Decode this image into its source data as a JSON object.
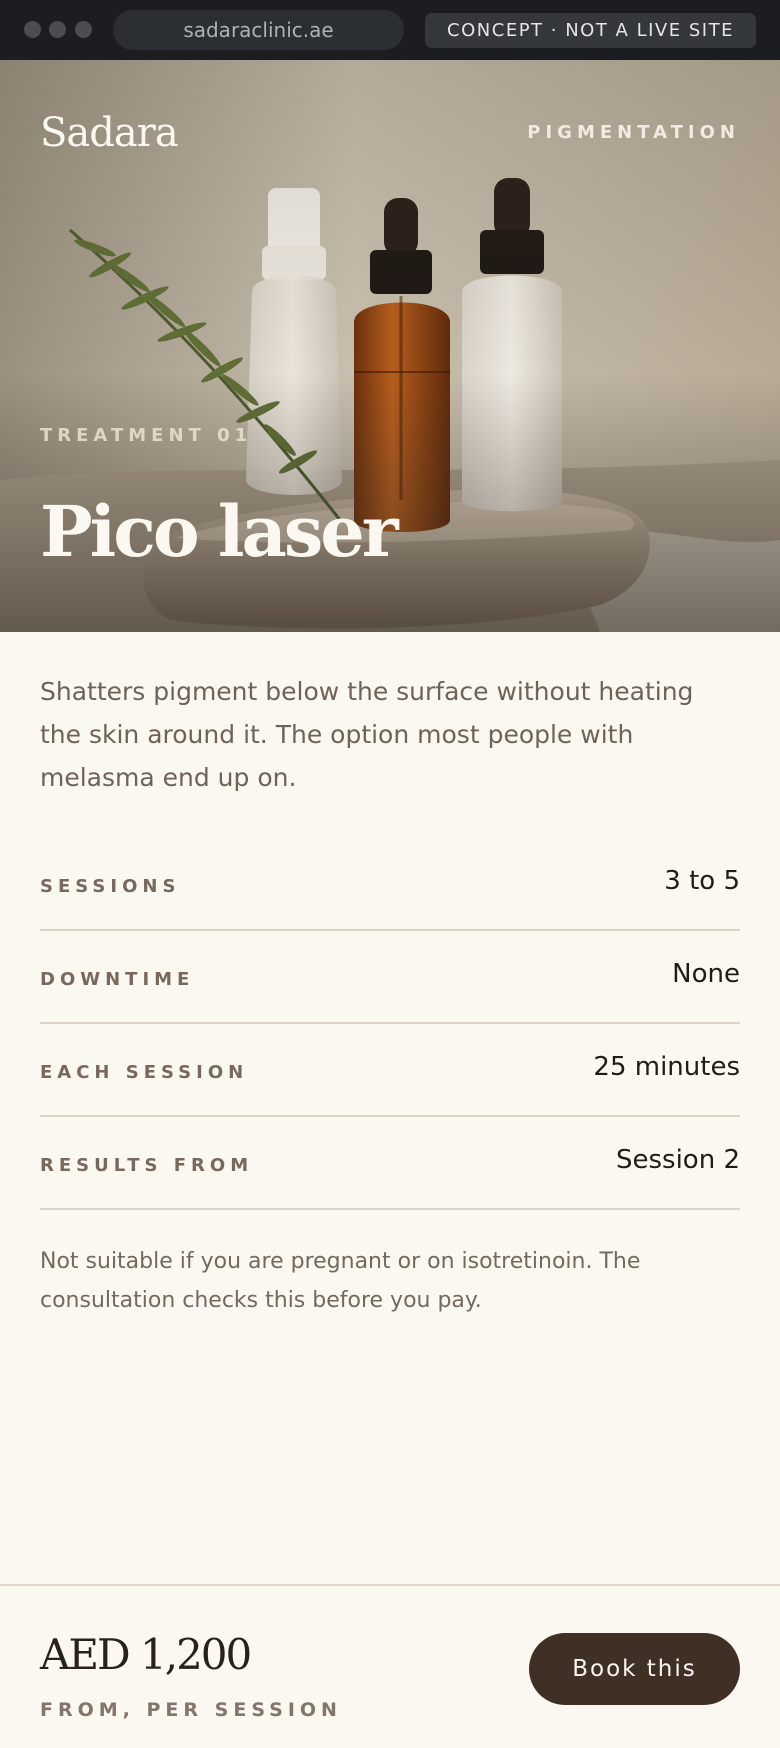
{
  "browser": {
    "url": "sadaraclinic.ae",
    "notice": "CONCEPT · NOT A LIVE SITE"
  },
  "hero": {
    "brand": "Sadara",
    "category": "PIGMENTATION",
    "eyebrow": "TREATMENT 01",
    "title": "Pico laser"
  },
  "intro": "Shatters pigment below the surface without heating the skin around it. The option most people with melasma end up on.",
  "facts": [
    {
      "label": "SESSIONS",
      "value": "3 to 5"
    },
    {
      "label": "DOWNTIME",
      "value": "None"
    },
    {
      "label": "EACH SESSION",
      "value": "25 minutes"
    },
    {
      "label": "RESULTS FROM",
      "value": "Session 2"
    }
  ],
  "note": "Not suitable if you are pregnant or on isotretinoin. The consultation checks this before you pay.",
  "footer": {
    "price": "AED 1,200",
    "price_sub": "FROM, PER SESSION",
    "cta": "Book this"
  },
  "colors": {
    "background": "#fbf7f1",
    "button": "#3f2f25",
    "browser_bar": "#1b1d20"
  }
}
